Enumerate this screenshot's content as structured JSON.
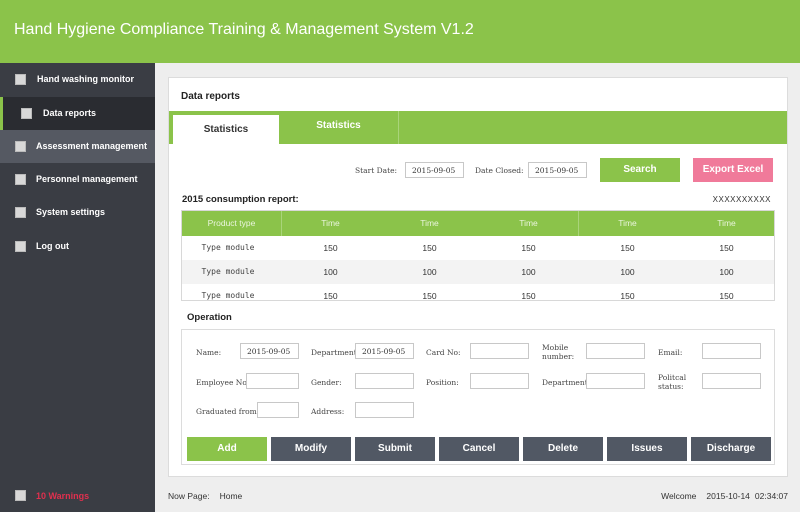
{
  "app": {
    "title": "Hand Hygiene Compliance Training & Management System V1.2"
  },
  "sidebar": {
    "items": [
      {
        "label": "Hand washing monitor"
      },
      {
        "label": "Data reports"
      },
      {
        "label": "Assessment management"
      },
      {
        "label": "Personnel management"
      },
      {
        "label": "System settings"
      },
      {
        "label": "Log out"
      }
    ],
    "warnings": "10 Warnings"
  },
  "panel": {
    "title": "Data reports"
  },
  "tabs": [
    {
      "label": "Statistics"
    },
    {
      "label": "Statistics"
    }
  ],
  "filter": {
    "start_label": "Start Date:",
    "start_value": "2015-09-05",
    "closed_label": "Date Closed:",
    "closed_value": "2015-09-05",
    "search_label": "Search",
    "export_label": "Export Excel"
  },
  "report": {
    "title": "2015 consumption report:",
    "code": "XXXXXXXXXX",
    "headers": [
      "Product type",
      "Time",
      "Time",
      "Time",
      "Time",
      "Time"
    ],
    "rows": [
      [
        "Type module",
        "150",
        "150",
        "150",
        "150",
        "150"
      ],
      [
        "Type module",
        "100",
        "100",
        "100",
        "100",
        "100"
      ],
      [
        "Type module",
        "150",
        "150",
        "150",
        "150",
        "150"
      ]
    ]
  },
  "operation": {
    "title": "Operation",
    "fields": {
      "name": {
        "label": "Name:",
        "value": "2015-09-05"
      },
      "department": {
        "label": "Department:",
        "value": "2015-09-05"
      },
      "card_no": {
        "label": "Card No:",
        "value": ""
      },
      "mobile": {
        "label": "Mobile number:",
        "value": ""
      },
      "email": {
        "label": "Email:",
        "value": ""
      },
      "employee_no": {
        "label": "Employee No:",
        "value": ""
      },
      "gender": {
        "label": "Gender:",
        "value": ""
      },
      "position": {
        "label": "Position:",
        "value": ""
      },
      "department2": {
        "label": "Department:",
        "value": ""
      },
      "political": {
        "label": "Politcal status:",
        "value": ""
      },
      "graduated": {
        "label": "Graduated from:",
        "value": ""
      },
      "address": {
        "label": "Address:",
        "value": ""
      }
    },
    "buttons": {
      "add": "Add",
      "modify": "Modify",
      "submit": "Submit",
      "cancel": "Cancel",
      "delete": "Delete",
      "issues": "Issues",
      "discharge": "Discharge"
    }
  },
  "footer": {
    "page_label": "Now Page:",
    "page_value": "Home",
    "welcome": "Welcome",
    "date": "2015-10-14",
    "time": "02:34:07"
  },
  "colors": {
    "accent": "#8bc34a",
    "sidebar": "#3a3d44",
    "export": "#f07a9a",
    "dark_button": "#515864",
    "warning_text": "#e0304e"
  }
}
